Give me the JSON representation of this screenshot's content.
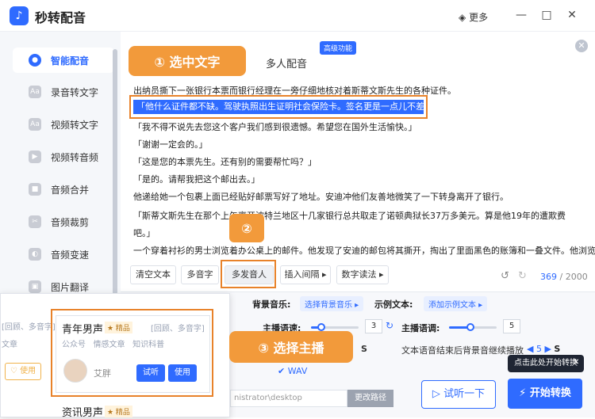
{
  "app": {
    "title": "秒转配音",
    "more": "更多"
  },
  "sidebar": {
    "items": [
      {
        "label": "智能配音",
        "icon": "mic-icon"
      },
      {
        "label": "录音转文字",
        "icon": "audio-text-icon"
      },
      {
        "label": "视频转文字",
        "icon": "video-text-icon"
      },
      {
        "label": "视频转音频",
        "icon": "video-audio-icon"
      },
      {
        "label": "音频合并",
        "icon": "merge-icon"
      },
      {
        "label": "音频裁剪",
        "icon": "scissors-icon"
      },
      {
        "label": "音频变速",
        "icon": "speed-icon"
      },
      {
        "label": "图片翻译",
        "icon": "image-translate-icon"
      }
    ]
  },
  "tabs": {
    "multi": "多人配音",
    "badge": "高级功能"
  },
  "text_lines": [
    "出纳员撕下一张银行本票而银行经理在一旁仔细地核对着斯蒂文斯先生的各种证件。",
    "「他什么证件都不缺。驾驶执照出生证明社会保险卡。签名更是一点儿不差。」",
    "「我不得不说先去您这个客户我们感到很遗憾。希望您在国外生活愉快。」",
    "「谢谢一定会的。」",
    "「这是您的本票先生。还有别的需要帮忙吗？」",
    "「是的。请帮我把这个邮出去。」",
    "他递给她一个包裹上面已经贴好邮票写好了地址。安迪冲他们友善地微笑了一下转身离开了银行。",
    "「斯蒂文斯先生在那个上午离开波特兰地区十几家银行总共取走了诺顿典狱长37万多美元。算是他19年的遭欺费",
    "吧。」",
    "一个穿着衬衫的男士浏览着办公桌上的邮件。他发现了安迪的邮包将其撕开，掏出了里面黑色的账簿和一叠文件。他浏览"
  ],
  "callouts": {
    "step1": "① 选中文字",
    "step2": "②",
    "step3": "③ 选择主播"
  },
  "toolbar": {
    "clear": "清空文本",
    "polyphone": "多音字",
    "multi_speaker": "多发音人",
    "insert_pause": "插入间隔 ▸",
    "digit_read": "数字读法 ▸",
    "count": "369",
    "total": "/ 2000"
  },
  "options": {
    "bgm_label": "背景音乐:",
    "bgm_btn": "选择背景音乐 ▸",
    "sample_label": "示例文本:",
    "sample_btn": "添加示例文本 ▸",
    "speed_label": "主播语速:",
    "speed_value": "3",
    "pitch_label": "主播语调:",
    "pitch_value": "5",
    "bgm_continue": "文本语音结束后背景音继续播放",
    "continue_value": "5",
    "format": "WAV",
    "path": "nistrator\\desktop",
    "change_path": "更改路径"
  },
  "voices": {
    "card": {
      "name": "青年男声",
      "tag": "★ 精品",
      "extra": "[回顾、多音字]",
      "cat1": "公众号",
      "cat2": "情感文章",
      "cat3": "知识科普",
      "speaker": "艾胖",
      "listen": "试听",
      "use": "使用"
    },
    "next": {
      "name": "资讯男声",
      "tag": "★ 精品"
    },
    "side_left1": "[回顾、多音字]",
    "side_left2": "文章",
    "side_use": "使用"
  },
  "actions": {
    "tip": "点击此处开始转换",
    "try": "试听一下",
    "start": "开始转换"
  }
}
